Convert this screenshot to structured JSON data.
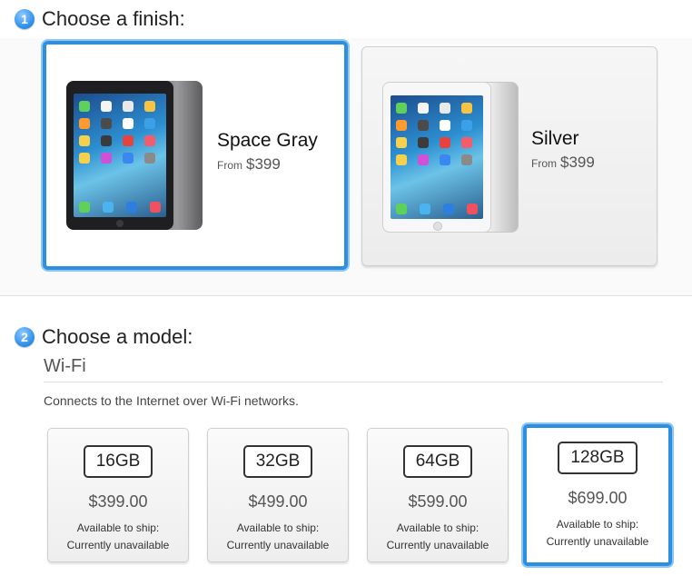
{
  "step1": {
    "badge": "1",
    "title": "Choose a finish:"
  },
  "finishes": [
    {
      "name": "Space Gray",
      "from_label": "From",
      "price": "$399",
      "selected": true
    },
    {
      "name": "Silver",
      "from_label": "From",
      "price": "$399",
      "selected": false
    }
  ],
  "step2": {
    "badge": "2",
    "title": "Choose a model:"
  },
  "connectivity": {
    "title": "Wi-Fi",
    "description": "Connects to the Internet over Wi-Fi networks."
  },
  "models": [
    {
      "capacity": "16GB",
      "price": "$399.00",
      "ship_label": "Available to ship:",
      "ship_status": "Currently unavailable",
      "selected": false
    },
    {
      "capacity": "32GB",
      "price": "$499.00",
      "ship_label": "Available to ship:",
      "ship_status": "Currently unavailable",
      "selected": false
    },
    {
      "capacity": "64GB",
      "price": "$599.00",
      "ship_label": "Available to ship:",
      "ship_status": "Currently unavailable",
      "selected": false
    },
    {
      "capacity": "128GB",
      "price": "$699.00",
      "ship_label": "Available to ship:",
      "ship_status": "Currently unavailable",
      "selected": true
    }
  ],
  "colors": {
    "accent": "#2d8fe0",
    "accent_glow": "#8cc6f4",
    "space_gray": "#2a2a2c",
    "silver": "#f2f2f2"
  }
}
